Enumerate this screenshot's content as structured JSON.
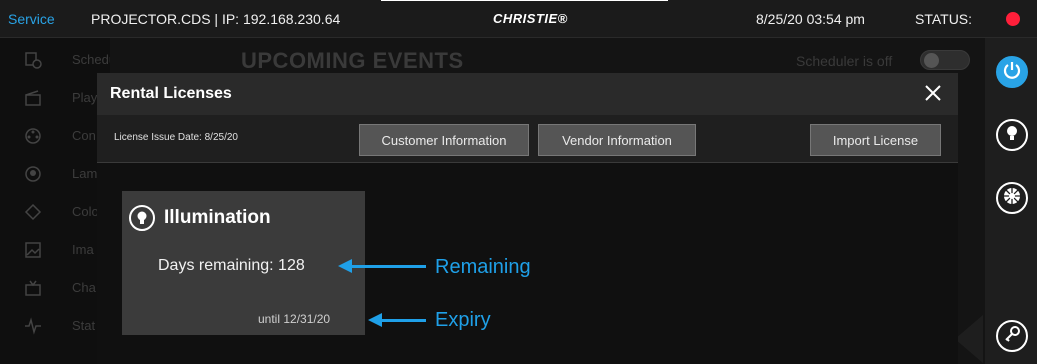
{
  "topbar": {
    "service": "Service",
    "projector": "PROJECTOR.CDS | IP: 192.168.230.64",
    "brand": "CHRISTIE®",
    "datetime": "8/25/20   03:54 pm",
    "status_label": "STATUS:",
    "status_color": "#ff1f3a"
  },
  "sidebar": {
    "items": [
      {
        "label": "Scheduler",
        "icon": "scheduler-icon"
      },
      {
        "label": "Play",
        "icon": "clapperboard-icon"
      },
      {
        "label": "Con",
        "icon": "film-reel-icon"
      },
      {
        "label": "Lam",
        "icon": "lamp-icon"
      },
      {
        "label": "Colo",
        "icon": "color-icon"
      },
      {
        "label": "Ima",
        "icon": "image-icon"
      },
      {
        "label": "Cha",
        "icon": "tv-icon"
      },
      {
        "label": "Stat",
        "icon": "pulse-icon"
      }
    ]
  },
  "background": {
    "title": "UPCOMING EVENTS",
    "scheduler_state": "Scheduler is off"
  },
  "modal": {
    "title": "Rental Licenses",
    "issue_date": "License Issue Date: 8/25/20",
    "buttons": {
      "customer": "Customer Information",
      "vendor": "Vendor Information",
      "import": "Import License"
    }
  },
  "card": {
    "title": "Illumination",
    "days_remaining": "Days remaining: 128",
    "until": "until 12/31/20"
  },
  "annotations": {
    "remaining": "Remaining",
    "expiry": "Expiry"
  },
  "colors": {
    "accent": "#29a3e6",
    "annotation": "#1fa0e8"
  }
}
